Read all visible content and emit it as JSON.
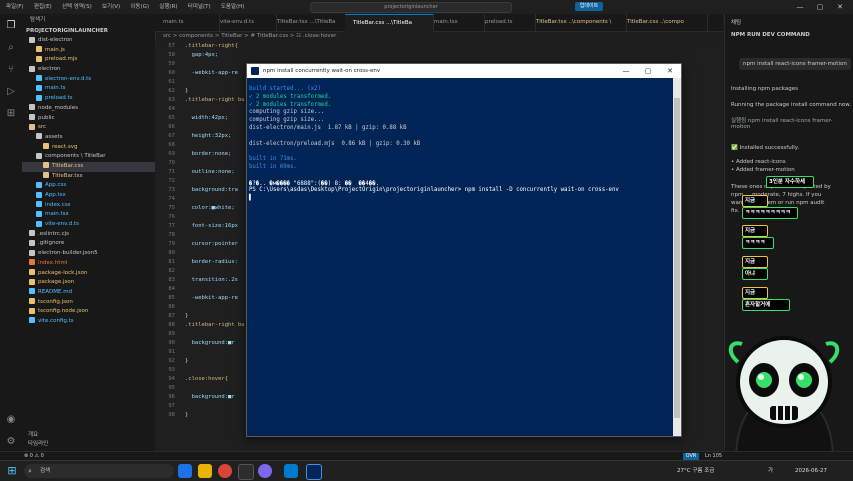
{
  "titlebar": {
    "menu": [
      "파일(F)",
      "편집(E)",
      "선택 영역(S)",
      "보기(V)",
      "이동(G)",
      "실행(R)",
      "터미널(T)",
      "도움말(H)"
    ],
    "search": "projectoriginlauncher",
    "update_label": "업데이트",
    "min": "—",
    "max": "▢",
    "close": "✕"
  },
  "sidebar": {
    "header": "탐색기",
    "project": "PROJECTORIGINLAUNCHER",
    "tree": [
      {
        "label": "dist-electron",
        "depth": 1,
        "color": "#c5c5c5"
      },
      {
        "label": "main.js",
        "depth": 2,
        "color": "#e8c36b"
      },
      {
        "label": "preload.mjs",
        "depth": 2,
        "color": "#e8c36b"
      },
      {
        "label": "electron",
        "depth": 1,
        "color": "#c5c5c5"
      },
      {
        "label": "electron-env.d.ts",
        "depth": 2,
        "color": "#4fc1ff"
      },
      {
        "label": "main.ts",
        "depth": 2,
        "color": "#4fc1ff"
      },
      {
        "label": "preload.ts",
        "depth": 2,
        "color": "#4fc1ff"
      },
      {
        "label": "node_modules",
        "depth": 1,
        "color": "#c5c5c5"
      },
      {
        "label": "public",
        "depth": 1,
        "color": "#c5c5c5"
      },
      {
        "label": "src",
        "depth": 1,
        "color": "#e2c08d"
      },
      {
        "label": "assets",
        "depth": 2,
        "color": "#c5c5c5"
      },
      {
        "label": "react.svg",
        "depth": 3,
        "color": "#e8c36b"
      },
      {
        "label": "components \\ TitleBar",
        "depth": 2,
        "color": "#c5c5c5"
      },
      {
        "label": "TitleBar.css",
        "depth": 3,
        "color": "#e2c08d",
        "sel": true
      },
      {
        "label": "TitleBar.tsx",
        "depth": 3,
        "color": "#e2c08d"
      },
      {
        "label": "App.css",
        "depth": 2,
        "color": "#4fc1ff"
      },
      {
        "label": "App.tsx",
        "depth": 2,
        "color": "#4fc1ff"
      },
      {
        "label": "index.css",
        "depth": 2,
        "color": "#4fc1ff"
      },
      {
        "label": "main.tsx",
        "depth": 2,
        "color": "#4fc1ff"
      },
      {
        "label": "vite-env.d.ts",
        "depth": 2,
        "color": "#4fc1ff"
      },
      {
        "label": ".eslintrc.cjs",
        "depth": 1,
        "color": "#c5c5c5"
      },
      {
        "label": ".gitignore",
        "depth": 1,
        "color": "#c5c5c5"
      },
      {
        "label": "electron-builder.json5",
        "depth": 1,
        "color": "#c5c5c5"
      },
      {
        "label": "index.html",
        "depth": 1,
        "color": "#e37933"
      },
      {
        "label": "package-lock.json",
        "depth": 1,
        "color": "#e8c36b"
      },
      {
        "label": "package.json",
        "depth": 1,
        "color": "#e8c36b"
      },
      {
        "label": "README.md",
        "depth": 1,
        "color": "#4fc1ff"
      },
      {
        "label": "tsconfig.json",
        "depth": 1,
        "color": "#e8c36b"
      },
      {
        "label": "tsconfig.node.json",
        "depth": 1,
        "color": "#e8c36b"
      },
      {
        "label": "vite.config.ts",
        "depth": 1,
        "color": "#4fc1ff"
      }
    ],
    "outline": [
      "개요",
      "타임라인"
    ]
  },
  "tabs": [
    {
      "label": "main.ts",
      "mod": false,
      "active": false
    },
    {
      "label": "vite-env.d.ts",
      "mod": false,
      "active": false
    },
    {
      "label": "TitleBar.tsx ...\\TitleBa",
      "mod": false,
      "active": false
    },
    {
      "label": "TitleBar.css ...\\TitleBa",
      "mod": false,
      "active": true
    },
    {
      "label": "main.tsx",
      "mod": false,
      "active": false
    },
    {
      "label": "preload.ts",
      "mod": false,
      "active": false
    },
    {
      "label": "TitleBar.tsx ..\\components \\",
      "mod": true,
      "active": false
    },
    {
      "label": "TitleBar.css ..\\compo",
      "mod": true,
      "active": false
    }
  ],
  "breadcrumb": "src > components > TitleBar > # TitleBar.css > ☷ .close:hover",
  "code": [
    {
      "n": "57",
      "t": ".titlebar-right{",
      "c": "#d7ba7d"
    },
    {
      "n": "58",
      "t": "  gap:4px;",
      "c": "#9cdcfe"
    },
    {
      "n": "59",
      "t": "",
      "c": "#ccc"
    },
    {
      "n": "60",
      "t": "  -webkit-app-re",
      "c": "#9cdcfe"
    },
    {
      "n": "61",
      "t": "",
      "c": "#ccc"
    },
    {
      "n": "62",
      "t": "}",
      "c": "#ccc"
    },
    {
      "n": "63",
      "t": ".titlebar-right bu",
      "c": "#d7ba7d"
    },
    {
      "n": "64",
      "t": "",
      "c": "#ccc"
    },
    {
      "n": "65",
      "t": "  width:42px;",
      "c": "#9cdcfe"
    },
    {
      "n": "66",
      "t": "",
      "c": "#ccc"
    },
    {
      "n": "67",
      "t": "  height:32px;",
      "c": "#9cdcfe"
    },
    {
      "n": "68",
      "t": "",
      "c": "#ccc"
    },
    {
      "n": "69",
      "t": "  border:none;",
      "c": "#9cdcfe"
    },
    {
      "n": "70",
      "t": "",
      "c": "#ccc"
    },
    {
      "n": "71",
      "t": "  outline:none;",
      "c": "#9cdcfe"
    },
    {
      "n": "72",
      "t": "",
      "c": "#ccc"
    },
    {
      "n": "73",
      "t": "  background:tra",
      "c": "#9cdcfe"
    },
    {
      "n": "74",
      "t": "",
      "c": "#ccc"
    },
    {
      "n": "75",
      "t": "  color:■white;",
      "c": "#9cdcfe"
    },
    {
      "n": "76",
      "t": "",
      "c": "#ccc"
    },
    {
      "n": "77",
      "t": "  font-size:16px",
      "c": "#9cdcfe"
    },
    {
      "n": "78",
      "t": "",
      "c": "#ccc"
    },
    {
      "n": "79",
      "t": "  cursor:pointer",
      "c": "#9cdcfe"
    },
    {
      "n": "80",
      "t": "",
      "c": "#ccc"
    },
    {
      "n": "81",
      "t": "  border-radius:",
      "c": "#9cdcfe"
    },
    {
      "n": "82",
      "t": "",
      "c": "#ccc"
    },
    {
      "n": "83",
      "t": "  transition:.2s",
      "c": "#9cdcfe"
    },
    {
      "n": "84",
      "t": "",
      "c": "#ccc"
    },
    {
      "n": "85",
      "t": "  -webkit-app-re",
      "c": "#9cdcfe"
    },
    {
      "n": "86",
      "t": "",
      "c": "#ccc"
    },
    {
      "n": "87",
      "t": "}",
      "c": "#ccc"
    },
    {
      "n": "88",
      "t": ".titlebar-right bu",
      "c": "#d7ba7d"
    },
    {
      "n": "89",
      "t": "",
      "c": "#ccc"
    },
    {
      "n": "90",
      "t": "  background:■r",
      "c": "#9cdcfe"
    },
    {
      "n": "91",
      "t": "",
      "c": "#ccc"
    },
    {
      "n": "92",
      "t": "}",
      "c": "#ccc"
    },
    {
      "n": "93",
      "t": "",
      "c": "#ccc"
    },
    {
      "n": "94",
      "t": ".close:hover{",
      "c": "#d7ba7d"
    },
    {
      "n": "95",
      "t": "",
      "c": "#ccc"
    },
    {
      "n": "96",
      "t": "  background:■r",
      "c": "#9cdcfe"
    },
    {
      "n": "97",
      "t": "",
      "c": "#ccc"
    },
    {
      "n": "98",
      "t": "}",
      "c": "#ccc"
    }
  ],
  "right_panel": {
    "title": "채팅",
    "section": "NPM RUN DEV COMMAND",
    "bubble": "npm install react-icons framer-motion",
    "lines": [
      "Installing npm packages",
      "Running the package install command now.",
      "실행됨  npm install react-icons framer-",
      "motion",
      "✅ Installed successfully.",
      "• Added react-icons",
      "• Added framer-motion",
      "These ones deprecation reported by",
      "npm ... moderate, 7 highs. If you",
      "want ... fix them or run npm audit",
      "fix."
    ]
  },
  "overlays": [
    "3인분 자수하세",
    "지금",
    "ㅋㅋㅋㅋㅋㅋㅋㅋㅋ",
    "지금",
    "ㅋㅋㅋㅋ",
    "지금",
    "아냐",
    "지금",
    "혼자할거에"
  ],
  "terminal": {
    "title": "npm install concurrently wait-on cross-env",
    "min": "—",
    "max": "▢",
    "close": "✕",
    "lines": [
      {
        "t": "build started... (x2)",
        "c": "#3b8eea"
      },
      {
        "t": "✓ 2 modules transformed.",
        "c": "#23d18b"
      },
      {
        "t": "✓ 2 modules transformed.",
        "c": "#23d18b"
      },
      {
        "t": "computing gzip size...",
        "c": "#cccccc"
      },
      {
        "t": "computing gzip size...",
        "c": "#cccccc"
      },
      {
        "t": "dist-electron/main.js  1.87 kB │ gzip: 0.88 kB",
        "c": "#cccccc"
      },
      {
        "t": "",
        "c": "#cccccc"
      },
      {
        "t": "dist-electron/preload.mjs  0.86 kB │ gzip: 0.30 kB",
        "c": "#cccccc"
      },
      {
        "t": "",
        "c": "#cccccc"
      },
      {
        "t": "built in 71ms.",
        "c": "#3b8eea"
      },
      {
        "t": "built in 69ms.",
        "c": "#3b8eea"
      },
      {
        "t": "",
        "c": "#cccccc"
      },
      {
        "t": "�?�.. �м�ּ��� \"6888\":(��) 8: ��  ��4��.",
        "c": "#ffffff"
      },
      {
        "t": "PS C:\\Users\\asdas\\Desktop\\ProjectOrigin\\projectoriginlauncher> npm install -D concurrently wait-on cross-env",
        "c": "#ffffff"
      },
      {
        "t": "▌",
        "c": "#ffffff"
      }
    ]
  },
  "status": {
    "left": "⊗ 0 ⚠ 0",
    "ovr": "OVR",
    "right": "Ln 105"
  },
  "taskbar": {
    "search": "검색",
    "temp": "27°C  구름 조금",
    "time": "2026-06-27",
    "lang": "가"
  }
}
